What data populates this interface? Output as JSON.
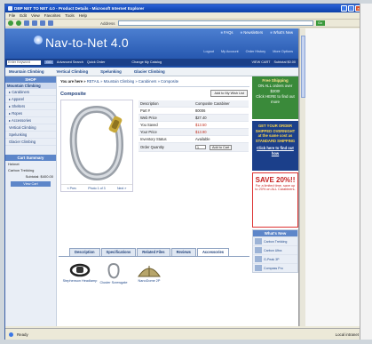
{
  "window": {
    "title": "DBP NET TO NET 4.0 - Product Details - Microsoft Internet Explorer"
  },
  "menubar": [
    "File",
    "Edit",
    "View",
    "Favorites",
    "Tools",
    "Help"
  ],
  "toolbar": {
    "address_label": "Address",
    "go_label": "Go"
  },
  "banner": {
    "logo": "Nav-to-Net 4.0",
    "topnav": [
      "FAQs",
      "Newsletters",
      "What's New"
    ],
    "subnav": [
      "Logout",
      "My Account",
      "Order History",
      "More Options"
    ],
    "search_placeholder": "Enter Keyword",
    "search_go": "GO",
    "advanced": "Advanced Search",
    "quick_order": "Quick Order",
    "change_catalog": "Change My Catalog",
    "view_cart": "VIEW CART",
    "subtotal": "Subtotal $0.00"
  },
  "catbar": [
    "Mountain Climbing",
    "Vertical Climbing",
    "Spelunking",
    "Glacier Climbing"
  ],
  "sidebar": {
    "shop_title": "SHOP",
    "section": "Mountain Climbing",
    "items": [
      "Carabiners",
      "Apparel",
      "Shelters",
      "Ropes",
      "Accessories",
      "Vertical Climbing",
      "Spelunking",
      "Glacier Climbing"
    ],
    "cart_title": "Cart Summary",
    "cart_items": [
      "Helmet",
      "Carbon Trekking"
    ],
    "subtotal": "Subtotal: $400.00",
    "view_cart": "View Cart"
  },
  "breadcrumb": {
    "prefix": "You are here »",
    "path": "RETAIL » Mountain Climbing » Carabiners » Composite"
  },
  "product": {
    "title": "Composite",
    "wishlist": "Add to My Wish List",
    "specs": [
      {
        "k": "Description",
        "v": "Composite Carabiner"
      },
      {
        "k": "Part #",
        "v": "80006"
      },
      {
        "k": "Web Price",
        "v": "$27.40"
      },
      {
        "k": "You Saved",
        "v": "$13.50"
      },
      {
        "k": "Your Price",
        "v": "$13.90"
      },
      {
        "k": "Inventory Status",
        "v": "Available"
      }
    ],
    "qty_label": "Order Quantity",
    "qty_value": "1",
    "add_to_cart": "Add to Cart",
    "image_links": [
      "« Prev",
      "Photo 1 of 3",
      "Next »"
    ]
  },
  "tabs": [
    "Description",
    "Specifications",
    "Related Files",
    "Reviews",
    "Accessories"
  ],
  "accessories": [
    "Stephenson Headlamp",
    "Cluster Screwgate",
    "NanoDome 2P"
  ],
  "promos": {
    "p1_line1": "Free Shipping",
    "p1_line2": "ON ALL orders over $200!",
    "p1_line3": "Click HERE to find out more",
    "p2": "GET YOUR ORDER SHIPPED OVERNIGHT at the same cost as STANDARD SHIPPING",
    "p2_click": "Click here to find out how",
    "p3_save": "SAVE 20%!!",
    "p3_text": "For a limited time, save up to 20% on ALL Carabiners."
  },
  "whatsnew": {
    "title": "What's New",
    "items": [
      "Carbon Trekking",
      "Carbon Ultra",
      "G-Peak 3P",
      "Compass Pro"
    ]
  },
  "status": {
    "left": "Ready",
    "zone": "Local intranet"
  }
}
